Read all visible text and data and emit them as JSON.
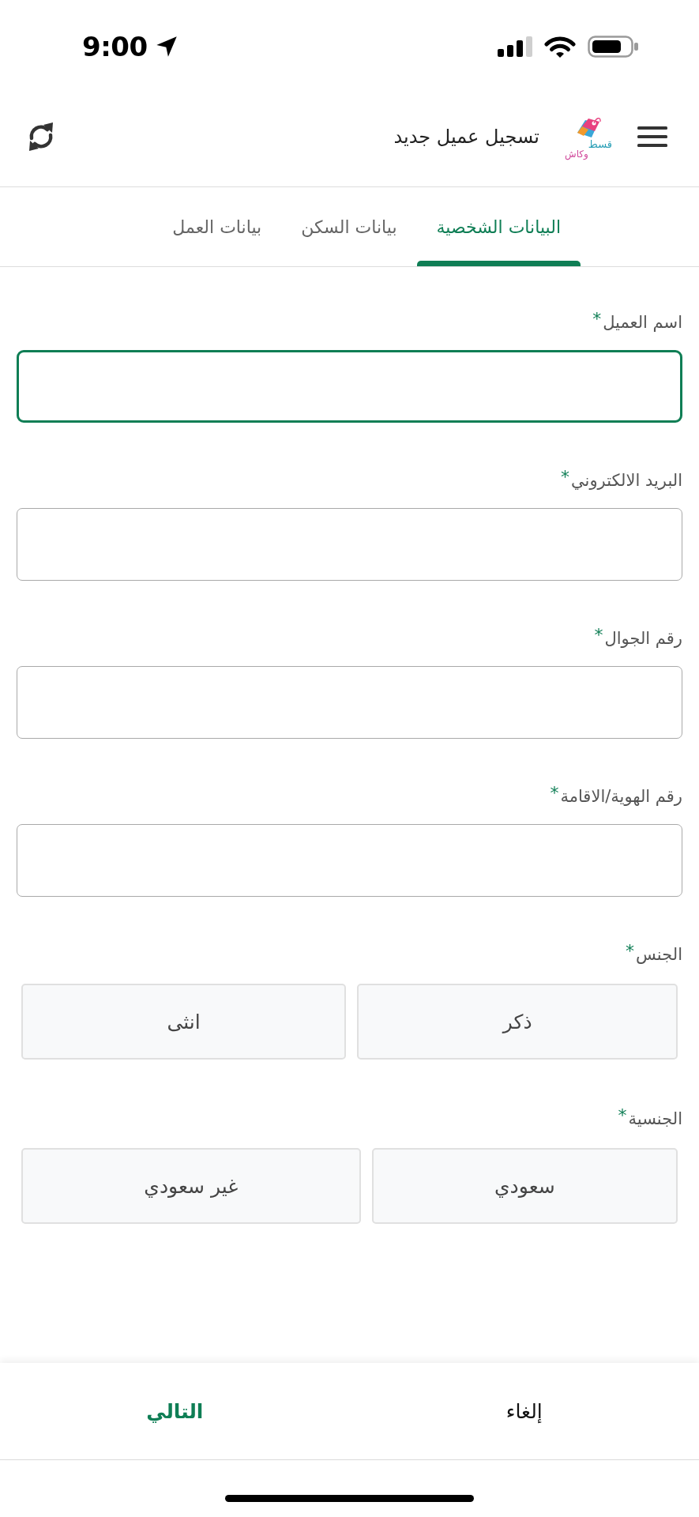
{
  "status_bar": {
    "time": "9:00"
  },
  "header": {
    "title": "تسجيل عميل جديد",
    "logo": {
      "line_1": "قسط",
      "line_2": "وكاش"
    }
  },
  "tabs": [
    {
      "label": "البيانات الشخصية",
      "selected": true
    },
    {
      "label": "بيانات السكن",
      "selected": false
    },
    {
      "label": "بيانات العمل",
      "selected": false
    }
  ],
  "fields": [
    {
      "label": "اسم العميل",
      "required_mark": "*",
      "focused": true
    },
    {
      "label": "البريد الالكتروني",
      "required_mark": "*",
      "focused": false
    },
    {
      "label": "رقم الجوال",
      "required_mark": "*",
      "focused": false
    },
    {
      "label": "رقم الهوية/الاقامة",
      "required_mark": "*",
      "focused": false
    }
  ],
  "choices": [
    {
      "label": "الجنس",
      "required_mark": "*",
      "options": [
        {
          "label": "ذكر",
          "selected": false
        },
        {
          "label": "انثى",
          "selected": false
        }
      ]
    },
    {
      "label": "الجنسية",
      "required_mark": "*",
      "options": [
        {
          "label": "سعودي",
          "selected": false
        },
        {
          "label": "غير سعودي",
          "selected": false
        }
      ]
    }
  ],
  "footer": {
    "buttons": [
      {
        "label": "إلغاء",
        "kind": "secondary"
      },
      {
        "label": "التالي",
        "kind": "primary"
      }
    ]
  }
}
